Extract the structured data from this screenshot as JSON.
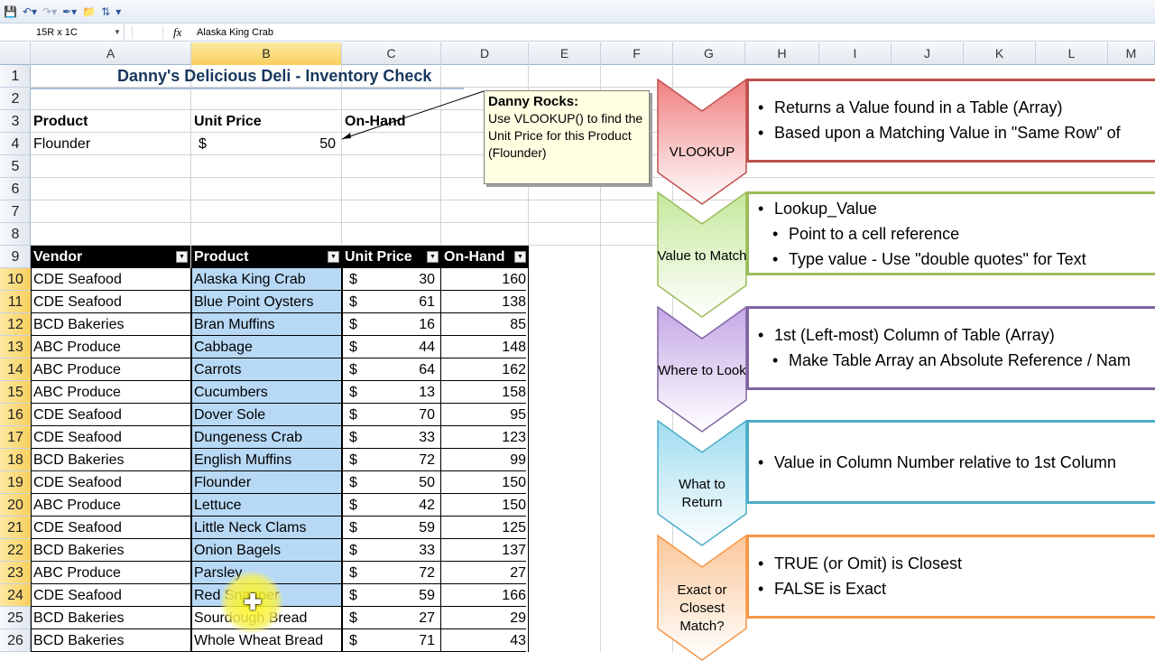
{
  "toolbar": {
    "icons": [
      "save-icon",
      "undo-icon",
      "redo-icon",
      "format-painter-icon",
      "open-folder-icon",
      "sort-icon",
      "customize-icon"
    ]
  },
  "formula_bar": {
    "name_box": "15R x 1C",
    "fx_label": "fx",
    "content": "Alaska King Crab"
  },
  "columns": [
    "A",
    "B",
    "C",
    "D",
    "E",
    "F",
    "G",
    "H",
    "I",
    "J",
    "K",
    "L",
    "M"
  ],
  "rows": [
    "1",
    "2",
    "3",
    "4",
    "5",
    "6",
    "7",
    "8",
    "9",
    "10",
    "11",
    "12",
    "13",
    "14",
    "15",
    "16",
    "17",
    "18",
    "19",
    "20",
    "21",
    "22",
    "23",
    "24",
    "25",
    "26"
  ],
  "sheet": {
    "title": "Danny's Delicious Deli - Inventory Check",
    "header": {
      "product": "Product",
      "unit_price": "Unit Price",
      "on_hand": "On-Hand"
    },
    "lookup": {
      "product": "Flounder",
      "currency": "$",
      "price": "50"
    }
  },
  "table": {
    "headers": [
      "Vendor",
      "Product",
      "Unit Price",
      "On-Hand"
    ],
    "currency": "$",
    "rows": [
      {
        "vendor": "CDE Seafood",
        "product": "Alaska King Crab",
        "price": "30",
        "onhand": "160"
      },
      {
        "vendor": "CDE Seafood",
        "product": "Blue Point Oysters",
        "price": "61",
        "onhand": "138"
      },
      {
        "vendor": "BCD Bakeries",
        "product": "Bran Muffins",
        "price": "16",
        "onhand": "85"
      },
      {
        "vendor": "ABC Produce",
        "product": "Cabbage",
        "price": "44",
        "onhand": "148"
      },
      {
        "vendor": "ABC Produce",
        "product": "Carrots",
        "price": "64",
        "onhand": "162"
      },
      {
        "vendor": "ABC Produce",
        "product": "Cucumbers",
        "price": "13",
        "onhand": "158"
      },
      {
        "vendor": "CDE Seafood",
        "product": "Dover Sole",
        "price": "70",
        "onhand": "95"
      },
      {
        "vendor": "CDE Seafood",
        "product": "Dungeness Crab",
        "price": "33",
        "onhand": "123"
      },
      {
        "vendor": "BCD Bakeries",
        "product": "English Muffins",
        "price": "72",
        "onhand": "99"
      },
      {
        "vendor": "CDE Seafood",
        "product": "Flounder",
        "price": "50",
        "onhand": "150"
      },
      {
        "vendor": "ABC Produce",
        "product": "Lettuce",
        "price": "42",
        "onhand": "150"
      },
      {
        "vendor": "CDE Seafood",
        "product": "Little Neck Clams",
        "price": "59",
        "onhand": "125"
      },
      {
        "vendor": "BCD Bakeries",
        "product": "Onion Bagels",
        "price": "33",
        "onhand": "137"
      },
      {
        "vendor": "ABC Produce",
        "product": "Parsley",
        "price": "72",
        "onhand": "27"
      },
      {
        "vendor": "CDE Seafood",
        "product": "Red Snapper",
        "price": "59",
        "onhand": "166"
      },
      {
        "vendor": "BCD Bakeries",
        "product": "Sourdough Bread",
        "price": "27",
        "onhand": "29"
      },
      {
        "vendor": "BCD Bakeries",
        "product": "Whole Wheat Bread",
        "price": "71",
        "onhand": "43"
      }
    ]
  },
  "callout": {
    "title": "Danny Rocks:",
    "text": "Use VLOOKUP() to find the Unit Price for this Product (Flounder)"
  },
  "smartart": [
    {
      "label": "VLOOKUP",
      "color": "#c0504d",
      "fill": "#f08080",
      "bullets": [
        {
          "text": "Returns a Value found in a Table (Array)",
          "level": 1
        },
        {
          "text": "Based upon a Matching Value in \"Same Row\" of",
          "level": 1
        }
      ]
    },
    {
      "label": "Value to Match",
      "color": "#9bbb59",
      "fill": "#c5e89a",
      "bullets": [
        {
          "text": "Lookup_Value",
          "level": 1
        },
        {
          "text": "Point to a cell reference",
          "level": 2
        },
        {
          "text": "Type value - Use \"double quotes\" for Text",
          "level": 2
        }
      ]
    },
    {
      "label": "Where to Look",
      "color": "#8064a2",
      "fill": "#c4a8e6",
      "bullets": [
        {
          "text": "1st (Left-most) Column of Table (Array)",
          "level": 1
        },
        {
          "text": "Make Table Array an Absolute Reference / Nam",
          "level": 2
        }
      ]
    },
    {
      "label": "What to Return",
      "color": "#4bacc6",
      "fill": "#9fdcf0",
      "bullets": [
        {
          "text": "Value in Column Number relative to 1st Column",
          "level": 1
        }
      ]
    },
    {
      "label": "Exact or Closest Match?",
      "color": "#f79646",
      "fill": "#fbc79a",
      "bullets": [
        {
          "text": "TRUE (or Omit) is Closest",
          "level": 1
        },
        {
          "text": "FALSE is Exact",
          "level": 1
        }
      ]
    }
  ]
}
